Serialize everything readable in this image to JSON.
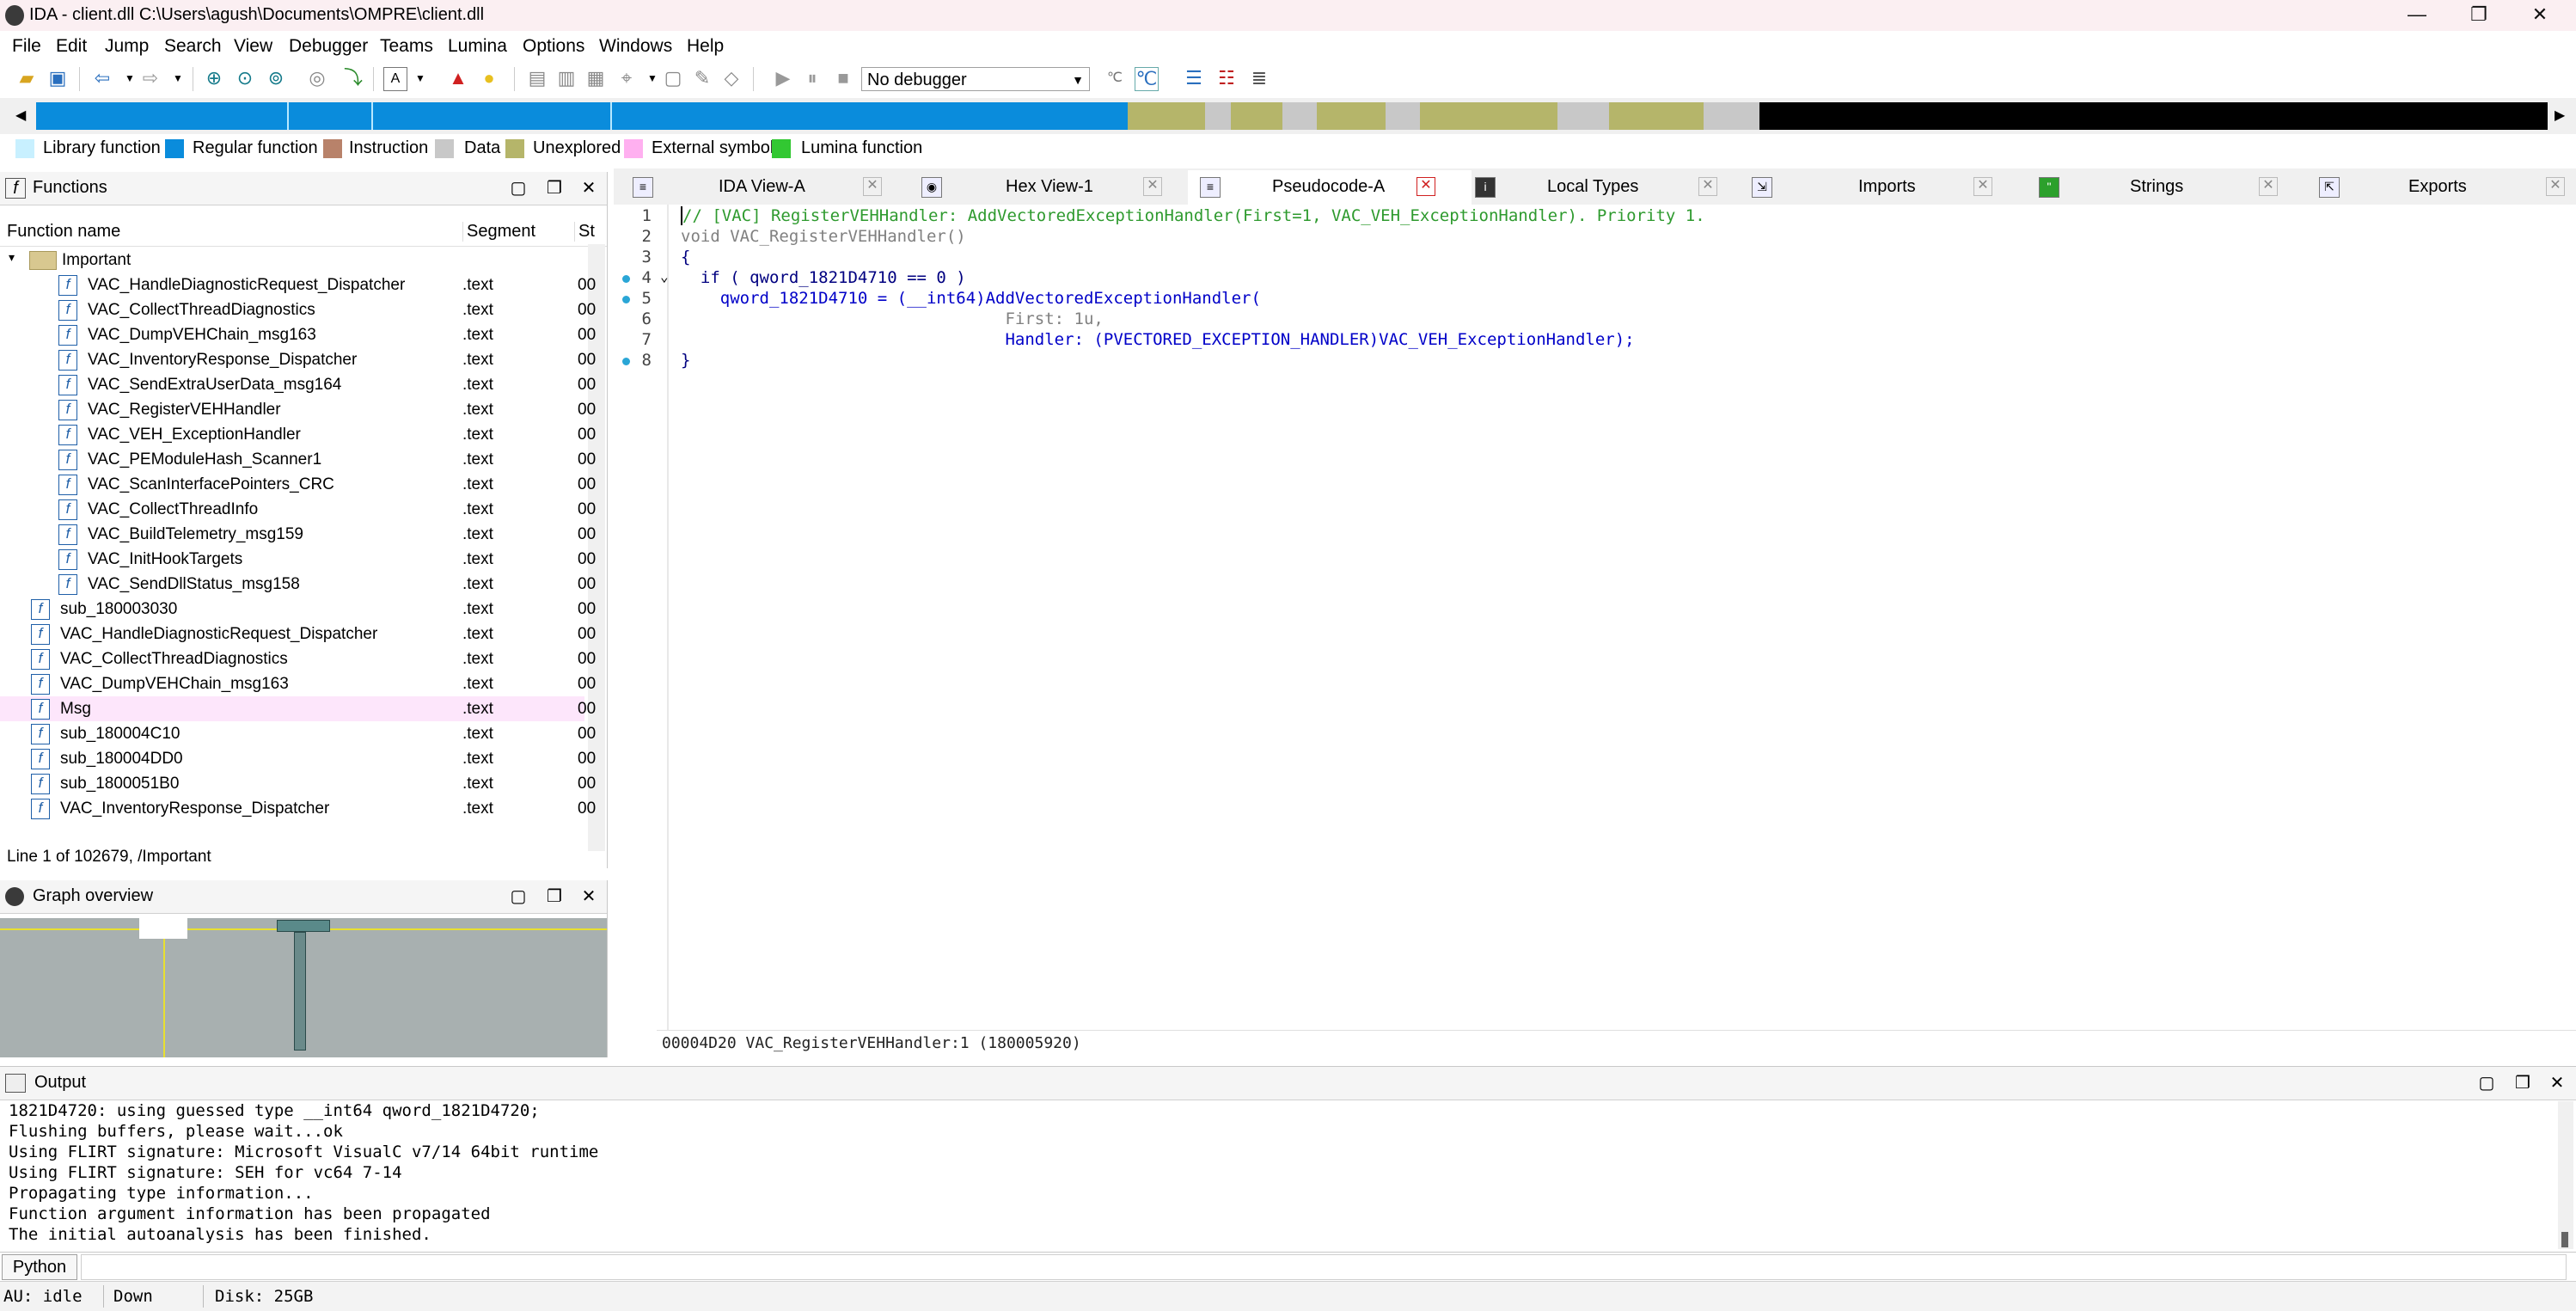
{
  "window": {
    "title": "IDA - client.dll C:\\Users\\agush\\Documents\\OMPRE\\client.dll",
    "minimize": "—",
    "maximize": "❐",
    "close": "✕"
  },
  "menu": [
    "File",
    "Edit",
    "Jump",
    "Search",
    "View",
    "Debugger",
    "Teams",
    "Lumina",
    "Options",
    "Windows",
    "Help"
  ],
  "toolbar": {
    "debugger_select": "No debugger"
  },
  "legend": [
    {
      "label": "Library function",
      "color": "#c8f0ff"
    },
    {
      "label": "Regular function",
      "color": "#0a8cdc"
    },
    {
      "label": "Instruction",
      "color": "#b8826a"
    },
    {
      "label": "Data",
      "color": "#c8c8c8"
    },
    {
      "label": "Unexplored",
      "color": "#b5b56a"
    },
    {
      "label": "External symbol",
      "color": "#ffb0f0"
    },
    {
      "label": "Lumina function",
      "color": "#32c832"
    }
  ],
  "functions_panel": {
    "title": "Functions",
    "col_name": "Function name",
    "col_segment": "Segment",
    "col_start": "St",
    "folder": "Important",
    "rows": [
      {
        "name": "VAC_HandleDiagnosticRequest_Dispatcher",
        "seg": ".text",
        "start": "00",
        "nested": true
      },
      {
        "name": "VAC_CollectThreadDiagnostics",
        "seg": ".text",
        "start": "00",
        "nested": true
      },
      {
        "name": "VAC_DumpVEHChain_msg163",
        "seg": ".text",
        "start": "00",
        "nested": true
      },
      {
        "name": "VAC_InventoryResponse_Dispatcher",
        "seg": ".text",
        "start": "00",
        "nested": true
      },
      {
        "name": "VAC_SendExtraUserData_msg164",
        "seg": ".text",
        "start": "00",
        "nested": true
      },
      {
        "name": "VAC_RegisterVEHHandler",
        "seg": ".text",
        "start": "00",
        "nested": true
      },
      {
        "name": "VAC_VEH_ExceptionHandler",
        "seg": ".text",
        "start": "00",
        "nested": true
      },
      {
        "name": "VAC_PEModuleHash_Scanner1",
        "seg": ".text",
        "start": "00",
        "nested": true
      },
      {
        "name": "VAC_ScanInterfacePointers_CRC",
        "seg": ".text",
        "start": "00",
        "nested": true
      },
      {
        "name": "VAC_CollectThreadInfo",
        "seg": ".text",
        "start": "00",
        "nested": true
      },
      {
        "name": "VAC_BuildTelemetry_msg159",
        "seg": ".text",
        "start": "00",
        "nested": true
      },
      {
        "name": "VAC_InitHookTargets",
        "seg": ".text",
        "start": "00",
        "nested": true
      },
      {
        "name": "VAC_SendDllStatus_msg158",
        "seg": ".text",
        "start": "00",
        "nested": true
      },
      {
        "name": "sub_180003030",
        "seg": ".text",
        "start": "00",
        "nested": false
      },
      {
        "name": "VAC_HandleDiagnosticRequest_Dispatcher",
        "seg": ".text",
        "start": "00",
        "nested": false
      },
      {
        "name": "VAC_CollectThreadDiagnostics",
        "seg": ".text",
        "start": "00",
        "nested": false
      },
      {
        "name": "VAC_DumpVEHChain_msg163",
        "seg": ".text",
        "start": "00",
        "nested": false
      },
      {
        "name": "Msg",
        "seg": ".text",
        "start": "00",
        "nested": false,
        "highlight": true
      },
      {
        "name": "sub_180004C10",
        "seg": ".text",
        "start": "00",
        "nested": false
      },
      {
        "name": "sub_180004DD0",
        "seg": ".text",
        "start": "00",
        "nested": false
      },
      {
        "name": "sub_1800051B0",
        "seg": ".text",
        "start": "00",
        "nested": false
      },
      {
        "name": "VAC_InventoryResponse_Dispatcher",
        "seg": ".text",
        "start": "00",
        "nested": false
      }
    ],
    "status": "Line 1 of 102679, /Important"
  },
  "graph_overview": {
    "title": "Graph overview"
  },
  "tabs": [
    {
      "label": "IDA View-A",
      "active": false
    },
    {
      "label": "Hex View-1",
      "active": false
    },
    {
      "label": "Pseudocode-A",
      "active": true
    },
    {
      "label": "Local Types",
      "active": false
    },
    {
      "label": "Imports",
      "active": false
    },
    {
      "label": "Strings",
      "active": false
    },
    {
      "label": "Exports",
      "active": false
    }
  ],
  "code": {
    "line_numbers": [
      "1",
      "2",
      "3",
      "4",
      "5",
      "6",
      "7",
      "8"
    ],
    "lines": [
      "// [VAC] RegisterVEHHandler: AddVectoredExceptionHandler(First=1, VAC_VEH_ExceptionHandler). Priority 1.",
      "void VAC_RegisterVEHHandler()",
      "{",
      "  if ( qword_1821D4710 == 0 )",
      "    qword_1821D4710 = (__int64)AddVectoredExceptionHandler(",
      "                                 First: 1u,",
      "                                 Handler: (PVECTORED_EXCEPTION_HANDLER)VAC_VEH_ExceptionHandler);",
      "}"
    ],
    "status": "00004D20 VAC_RegisterVEHHandler:1 (180005920)"
  },
  "output": {
    "title": "Output",
    "lines": [
      "1821D4720: using guessed type __int64 qword_1821D4720;",
      "Flushing buffers, please wait...ok",
      "Using FLIRT signature: Microsoft VisualC v7/14 64bit runtime",
      "Using FLIRT signature: SEH for vc64 7-14",
      "Propagating type information...",
      "Function argument information has been propagated",
      "The initial autoanalysis has been finished."
    ],
    "python_label": "Python"
  },
  "statusbar": {
    "au": "AU:  idle",
    "dir": "Down",
    "disk": "Disk: 25GB"
  },
  "colors": {
    "regular_function": "#0a8cdc",
    "unexplored": "#b5b56a",
    "data": "#c8c8c8",
    "black": "#000000",
    "comment": "#2e9a2e",
    "keyword": "#000080",
    "func_call": "#d020d0",
    "identifier": "#0000c8",
    "highlight_row": "#fde6fb"
  }
}
